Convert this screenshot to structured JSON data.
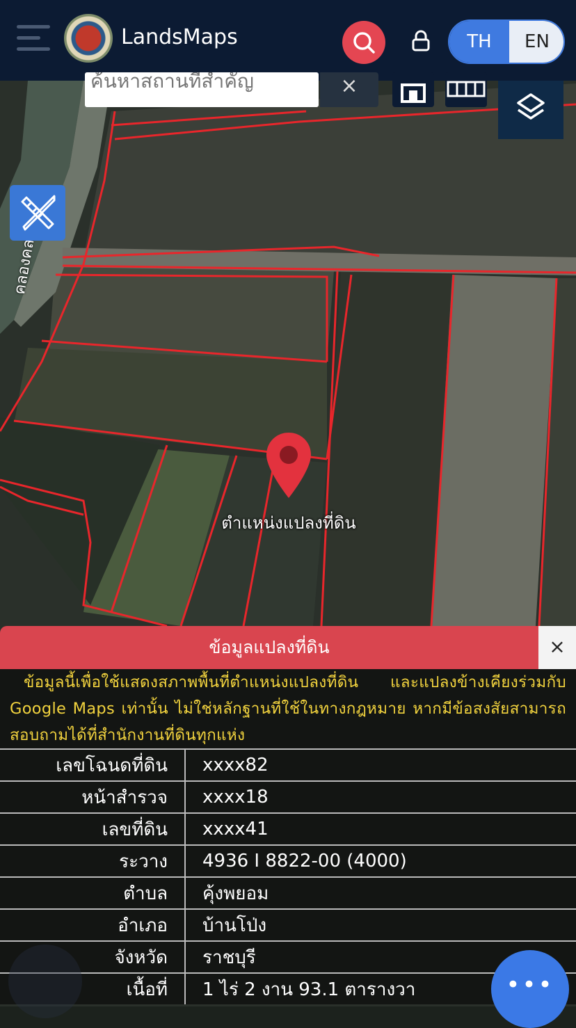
{
  "header": {
    "app_title": "LandsMaps",
    "menu_icon": "hamburger-icon",
    "logo_icon": "department-seal-logo",
    "search_icon": "search-icon",
    "lock_icon": "lock-icon",
    "lang_th": "TH",
    "lang_en": "EN",
    "accent_color": "#e44652",
    "lang_active_color": "#3f7ae0"
  },
  "search": {
    "placeholder": "ค้นหาสถานที่สำคัญ",
    "clear_label": "×"
  },
  "toolbar": {
    "office_icon": "land-office-icon",
    "grid_icon": "grid-icon",
    "layers_icon": "layers-icon",
    "draw_icon": "ruler-pencil-icon"
  },
  "map": {
    "road_label": "คลองคลองขวาง",
    "marker_label": "ตำแหน่งแปลงที่ดิน",
    "marker_icon": "map-pin-icon",
    "boundary_color": "#e8262b"
  },
  "info_panel": {
    "title": "ข้อมูลแปลงที่ดิน",
    "close_label": "×",
    "notice": "ข้อมูลนี้เพื่อใช้แสดงสภาพพื้นที่ตำแหน่งแปลงที่ดิน และแปลงข้างเคียงร่วมกับ Google Maps เท่านั้น ไม่ใช่หลักฐานที่ใช้ในทางกฎหมาย หากมีข้อสงสัยสามารถสอบถามได้ที่สำนักงานที่ดินทุกแห่ง",
    "notice_color": "#f2d33e",
    "header_color": "#d9454f",
    "rows": [
      {
        "label": "เลขโฉนดที่ดิน",
        "value": "xxxx82"
      },
      {
        "label": "หน้าสำรวจ",
        "value": "xxxx18"
      },
      {
        "label": "เลขที่ดิน",
        "value": "xxxx41"
      },
      {
        "label": "ระวาง",
        "value": "4936 I 8822-00 (4000)"
      },
      {
        "label": "ตำบล",
        "value": "คุ้งพยอม"
      },
      {
        "label": "อำเภอ",
        "value": "บ้านโป่ง"
      },
      {
        "label": "จังหวัด",
        "value": "ราชบุรี"
      },
      {
        "label": "เนื้อที่",
        "value": "1 ไร่ 2 งาน 93.1 ตารางวา"
      }
    ]
  },
  "fab": {
    "more_label": "•••",
    "more_icon": "more-dots-icon",
    "info_icon": "info-icon"
  }
}
